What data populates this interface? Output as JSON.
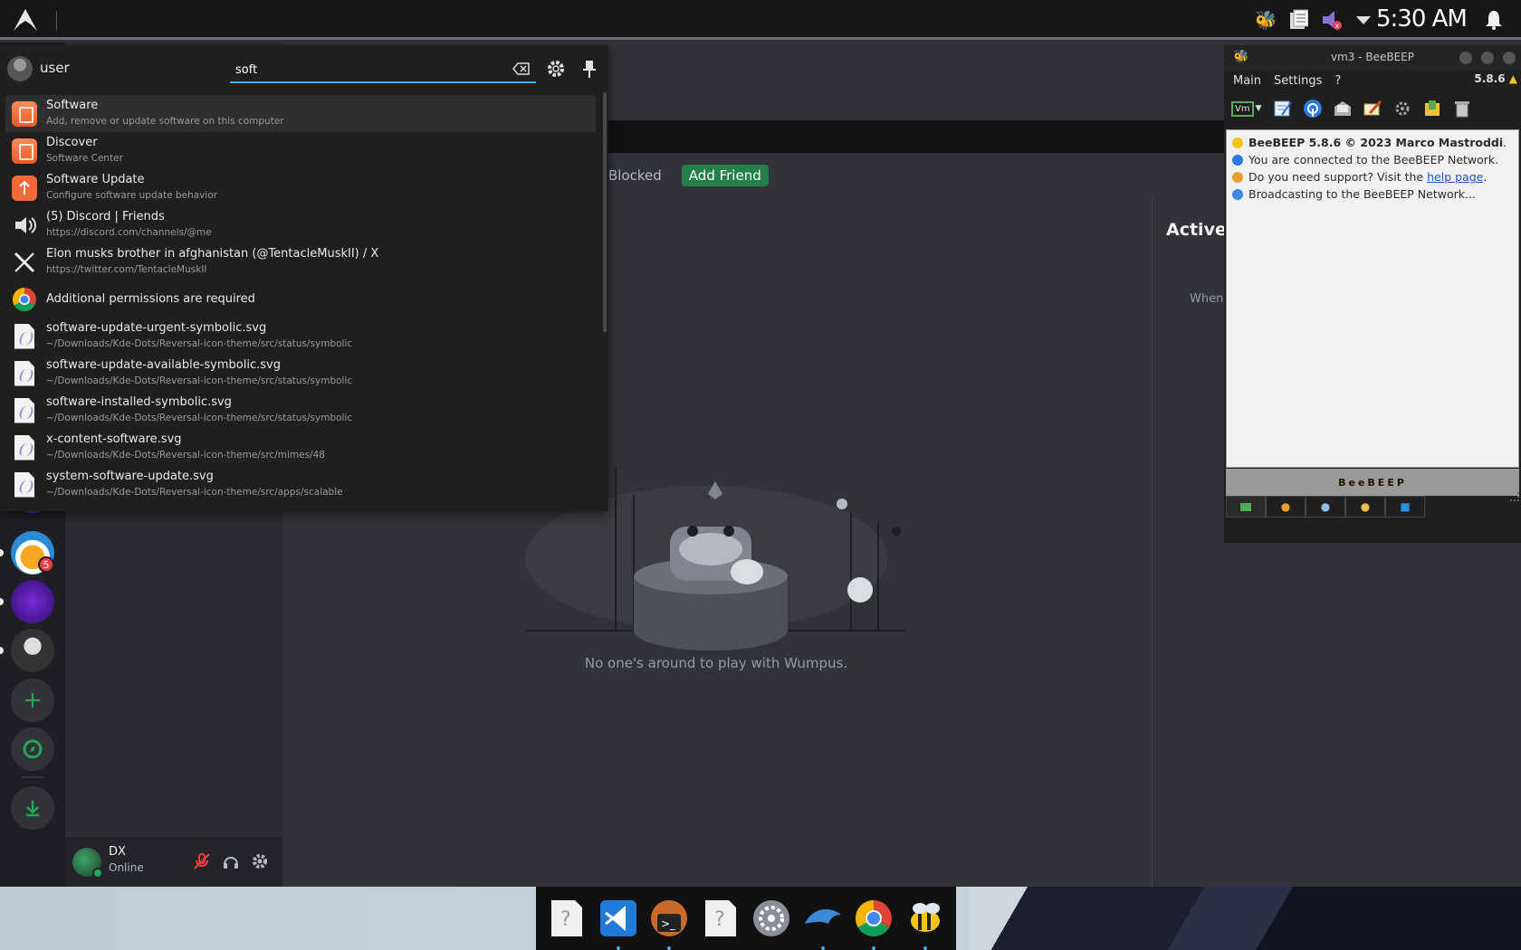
{
  "topbar": {
    "clock": "5:30 AM",
    "tray_icons": [
      "beebeep-tray-icon",
      "clipboard-icon",
      "mic-muted-icon",
      "expand-arrow-icon"
    ]
  },
  "discord": {
    "tabs": {
      "blocked": "Blocked",
      "add_friend": "Add Friend"
    },
    "active_now": {
      "title": "Active",
      "subtitle": "When"
    },
    "empty_state": "No one's around to play with Wumpus.",
    "guild_badge": "5",
    "user_panel": {
      "name": "DX",
      "status": "Online"
    },
    "colors": {
      "add_friend": "#248046",
      "online": "#23a55a",
      "badge": "#f23f43"
    }
  },
  "launcher": {
    "user": "user",
    "search": {
      "value": "soft"
    },
    "results": [
      {
        "title": "Software",
        "subtitle": "Add, remove or update software on this computer",
        "icon": "software-center-icon"
      },
      {
        "title": "Discover",
        "subtitle": "Software Center",
        "icon": "discover-icon"
      },
      {
        "title": "Software Update",
        "subtitle": "Configure software update behavior",
        "icon": "software-update-icon"
      },
      {
        "title": "(5) Discord | Friends",
        "subtitle": "https://discord.com/channels/@me",
        "icon": "speaker-icon"
      },
      {
        "title": "Elon musks brother in afghanistan (@TentacleMuskII) / X",
        "subtitle": "https://twitter.com/TentacleMuskII",
        "icon": "x-logo-icon"
      },
      {
        "title": "Additional permissions are required",
        "subtitle": "",
        "icon": "chrome-icon"
      },
      {
        "title": "software-update-urgent-symbolic.svg",
        "subtitle": "~/Downloads/Kde-Dots/Reversal-icon-theme/src/status/symbolic",
        "icon": "svg-file-icon"
      },
      {
        "title": "software-update-available-symbolic.svg",
        "subtitle": "~/Downloads/Kde-Dots/Reversal-icon-theme/src/status/symbolic",
        "icon": "svg-file-icon"
      },
      {
        "title": "software-installed-symbolic.svg",
        "subtitle": "~/Downloads/Kde-Dots/Reversal-icon-theme/src/status/symbolic",
        "icon": "svg-file-icon"
      },
      {
        "title": "x-content-software.svg",
        "subtitle": "~/Downloads/Kde-Dots/Reversal-icon-theme/src/mimes/48",
        "icon": "svg-file-icon"
      },
      {
        "title": "system-software-update.svg",
        "subtitle": "~/Downloads/Kde-Dots/Reversal-icon-theme/src/apps/scalable",
        "icon": "svg-file-icon"
      }
    ]
  },
  "beebeep": {
    "window_title": "vm3 - BeeBEEP",
    "version": "5.8.6",
    "menu": [
      "Main",
      "Settings",
      "?"
    ],
    "chat_lines": {
      "l1": "BeeBEEP 5.8.6 © 2023 Marco Mastroddi",
      "l1_tail": ".",
      "l2": "You are connected to the BeeBEEP Network.",
      "l3_pre": "Do you need support? Visit the ",
      "l3_link": "help page",
      "l3_post": ".",
      "l4": "Broadcasting to the BeeBEEP Network..."
    },
    "brand": "BeeBEEP",
    "toolbar_vm": "Vm"
  },
  "dock": {
    "apps": [
      "unknown-app-icon",
      "vscode-icon",
      "terminal-icon",
      "unknown-app-icon",
      "system-settings-icon",
      "dolphin-icon",
      "chrome-icon",
      "beebeep-icon"
    ]
  }
}
